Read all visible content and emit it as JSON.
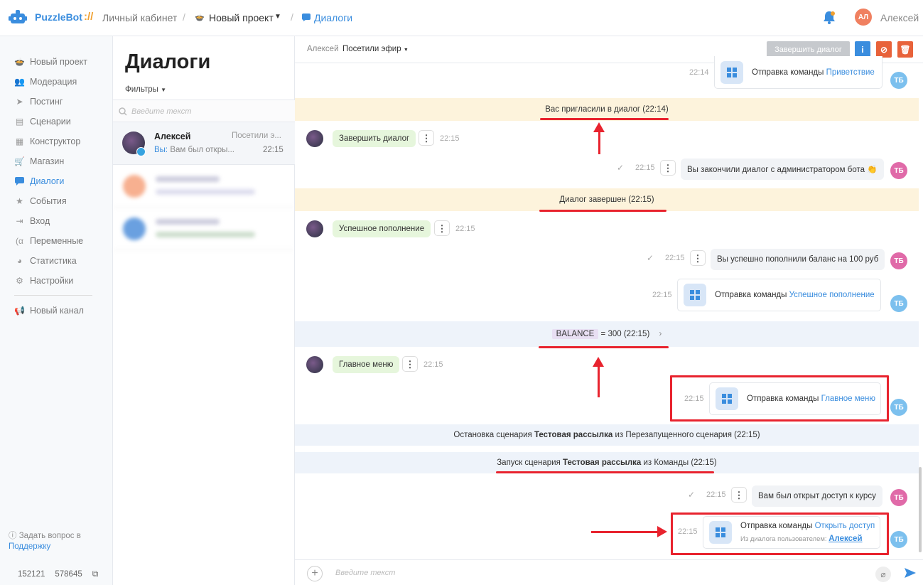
{
  "topbar": {
    "brand": "PuzzleBot",
    "brand_sep": "://",
    "crumb1": "Личный кабинет",
    "crumb2": "Новый проект",
    "crumb3": "Диалоги",
    "avatar_initials": "АЛ",
    "user_name": "Алексей"
  },
  "sidebar": {
    "items": [
      {
        "label": "Новый проект",
        "icon": "project-icon"
      },
      {
        "label": "Модерация",
        "icon": "users-icon"
      },
      {
        "label": "Постинг",
        "icon": "send-icon"
      },
      {
        "label": "Сценарии",
        "icon": "scenario-icon"
      },
      {
        "label": "Конструктор",
        "icon": "constructor-icon"
      },
      {
        "label": "Магазин",
        "icon": "cart-icon"
      },
      {
        "label": "Диалоги",
        "icon": "chat-icon"
      },
      {
        "label": "События",
        "icon": "star-icon"
      },
      {
        "label": "Вход",
        "icon": "login-icon"
      },
      {
        "label": "Переменные",
        "icon": "variable-icon"
      },
      {
        "label": "Статистика",
        "icon": "pie-icon"
      },
      {
        "label": "Настройки",
        "icon": "gear-icon"
      }
    ],
    "channel": "Новый канал",
    "help_text": "Задать вопрос в",
    "help_link": "Поддержку",
    "id1": "152121",
    "id2": "578645"
  },
  "list": {
    "title": "Диалоги",
    "filters": "Фильтры",
    "search_placeholder": "Введите текст",
    "chat": {
      "name": "Алексей",
      "tag": "Посетили э...",
      "prefix": "Вы:",
      "message": "Вам был откры...",
      "time": "22:15"
    }
  },
  "main": {
    "header_user": "Алексей",
    "header_tag": "Посетили эфир",
    "end_button": "Завершить диалог",
    "input_placeholder": "Введите текст",
    "cmd_prefix": "Отправка команды",
    "tb": "ТБ",
    "cmd1": {
      "time": "22:14",
      "link": "Приветствие"
    },
    "sys1": "Вас пригласили в диалог (22:14)",
    "u1": {
      "text": "Завершить диалог",
      "time": "22:15"
    },
    "b1": {
      "time": "22:15",
      "text": "Вы закончили диалог с администратором бота 👏"
    },
    "sys2": "Диалог завершен (22:15)",
    "u2": {
      "text": "Успешное пополнение",
      "time": "22:15"
    },
    "b2": {
      "time": "22:15",
      "text": "Вы успешно пополнили баланс на 100 руб"
    },
    "cmd2": {
      "time": "22:15",
      "link": "Успешное пополнение"
    },
    "var": {
      "name": "BALANCE",
      "text": "= 300 (22:15)"
    },
    "u3": {
      "text": "Главное меню",
      "time": "22:15"
    },
    "cmd3": {
      "time": "22:15",
      "link": "Главное меню"
    },
    "sys3": {
      "a": "Остановка сценария ",
      "b": "Тестовая рассылка",
      "c": " из Перезапущенного сценария (22:15)"
    },
    "sys4": {
      "a": "Запуск сценария ",
      "b": "Тестовая рассылка",
      "c": " из Команды (22:15)"
    },
    "b3": {
      "time": "22:15",
      "text": "Вам был открыт доступ к курсу"
    },
    "cmd4": {
      "time": "22:15",
      "link": "Открыть доступ",
      "sub": "Из диалога пользователем:",
      "sub_link": "Алексей"
    }
  },
  "colors": {
    "accent": "#3a8dde",
    "annotation": "#e8232e",
    "user_bubble": "#e6f6dc",
    "system_yellow": "#fdf3dc",
    "system_blue": "#eef3fa"
  }
}
